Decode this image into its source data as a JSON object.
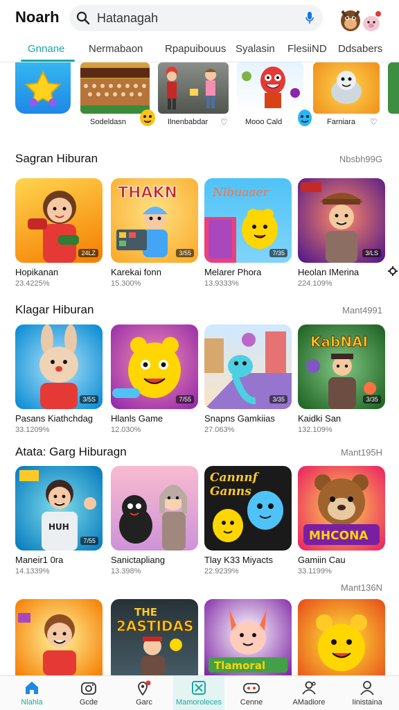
{
  "app": {
    "title": "Noarh"
  },
  "search": {
    "value": "Hatanagah"
  },
  "tabs": [
    {
      "label": "Gnnane"
    },
    {
      "label": "Nermabaon"
    },
    {
      "label": "Rpapuibouus"
    },
    {
      "label": "Syalasin"
    },
    {
      "label": "FlesiiND"
    },
    {
      "label": "Ddsabers"
    }
  ],
  "strip": [
    {
      "label": "Sodeldasn"
    },
    {
      "label": "Ilnenbabdar"
    },
    {
      "label": "Mooo Cald"
    },
    {
      "label": "Farniara"
    }
  ],
  "sections": [
    {
      "title": "Sagran Hiburan",
      "more": "Nbsbh99G",
      "cards": [
        {
          "title": "Hopikanan",
          "sub": "23.4225%",
          "badge": "24LZ"
        },
        {
          "title": "Karekai fonn",
          "sub": "15.300%",
          "badge": "3/55"
        },
        {
          "title": "Melarer Phora",
          "sub": "13.9333%",
          "badge": "7/35"
        },
        {
          "title": "Heolan IMerina",
          "sub": "224.109%",
          "badge": "3/LS"
        }
      ]
    },
    {
      "title": "Klagar Hiburan",
      "more": "Mant4991",
      "cards": [
        {
          "title": "Pasans Kiathchdag",
          "sub": "33.1209%",
          "badge": "3/5S"
        },
        {
          "title": "Hlanls Game",
          "sub": "12.030%",
          "badge": "7/55"
        },
        {
          "title": "Snapns Gamkiias",
          "sub": "27.063%",
          "badge": "3/35"
        },
        {
          "title": "Kaidkі San",
          "sub": "132.109%",
          "badge": "3/35"
        }
      ]
    },
    {
      "title": "Atata: Garg Hiburagn",
      "more": "Mant195H",
      "cards": [
        {
          "title": "Maneir1 0ra",
          "sub": "14.1339%",
          "badge": "7/55"
        },
        {
          "title": "Sanictapliang",
          "sub": "13.398%",
          "badge": ""
        },
        {
          "title": "Tlay K33 Miyacts",
          "sub": "22.9239%",
          "badge": ""
        },
        {
          "title": "Gamiin Cau",
          "sub": "33.1199%",
          "badge": ""
        }
      ]
    },
    {
      "title": "",
      "more": "Mant136N",
      "cards": [
        {
          "title": "",
          "sub": "",
          "badge": ""
        },
        {
          "title": "",
          "sub": "",
          "badge": ""
        },
        {
          "title": "",
          "sub": "",
          "badge": ""
        },
        {
          "title": "",
          "sub": "",
          "badge": ""
        }
      ]
    }
  ],
  "nav": [
    {
      "label": "Nlahla",
      "icon": "home-icon"
    },
    {
      "label": "Gcde",
      "icon": "controller-icon"
    },
    {
      "label": "Garc",
      "icon": "location-pin-icon"
    },
    {
      "label": "Mamoroleces",
      "icon": "crossed-box-icon"
    },
    {
      "label": "Cenne",
      "icon": "gamepad-icon"
    },
    {
      "label": "AMadiore",
      "icon": "people-icon"
    },
    {
      "label": "Iinistaina",
      "icon": "person-icon"
    }
  ],
  "colors": {
    "accent": "#1aa7a0",
    "text": "#111111",
    "muted": "#777777"
  }
}
